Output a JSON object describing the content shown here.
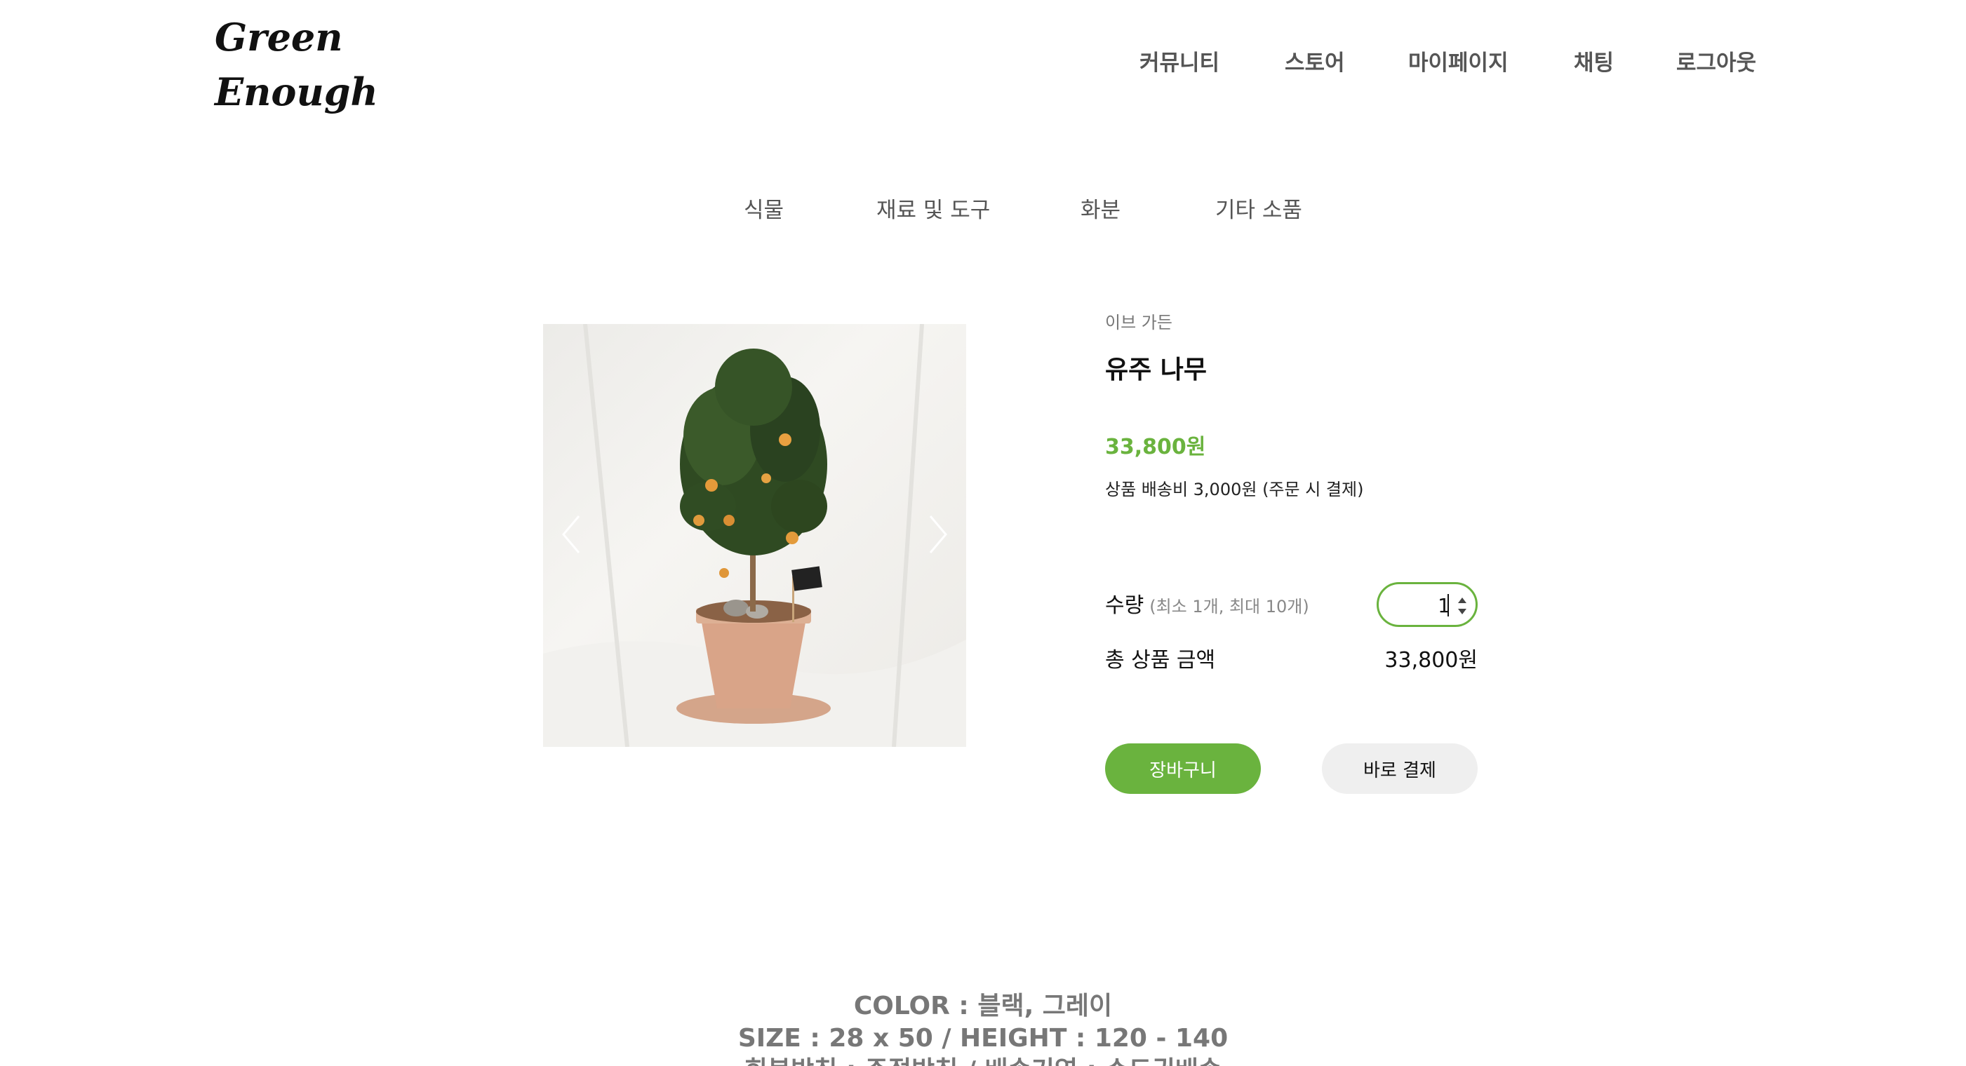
{
  "logo": {
    "line1": "Green",
    "line2": "Enough"
  },
  "top_nav": {
    "community": "커뮤니티",
    "store": "스토어",
    "mypage": "마이페이지",
    "chatting": "채팅",
    "logout": "로그아웃"
  },
  "category_nav": {
    "plants": "식물",
    "materials": "재료 및 도구",
    "pots": "화분",
    "etc": "기타 소품"
  },
  "product": {
    "brand": "이브 가든",
    "name": "유주 나무",
    "price": "33,800원",
    "shipping": "상품 배송비 3,000원 (주문 시 결제)",
    "quantity_label": "수량",
    "quantity_hint": "(최소 1개, 최대 10개)",
    "quantity_value": "1",
    "total_label": "총 상품 금액",
    "total_value": "33,800원",
    "cart_button": "장바구니",
    "buy_button": "바로 결제"
  },
  "description": {
    "line1": "COLOR : 블랙, 그레이",
    "line2": "SIZE : 28 x 50 / HEIGHT : 120 - 140",
    "line3": "회복방침 : 주접방침 / 배송기영 : 수도권배송"
  },
  "colors": {
    "accent": "#6ab33e",
    "nav_text": "#555555",
    "secondary_button": "#efefef"
  }
}
